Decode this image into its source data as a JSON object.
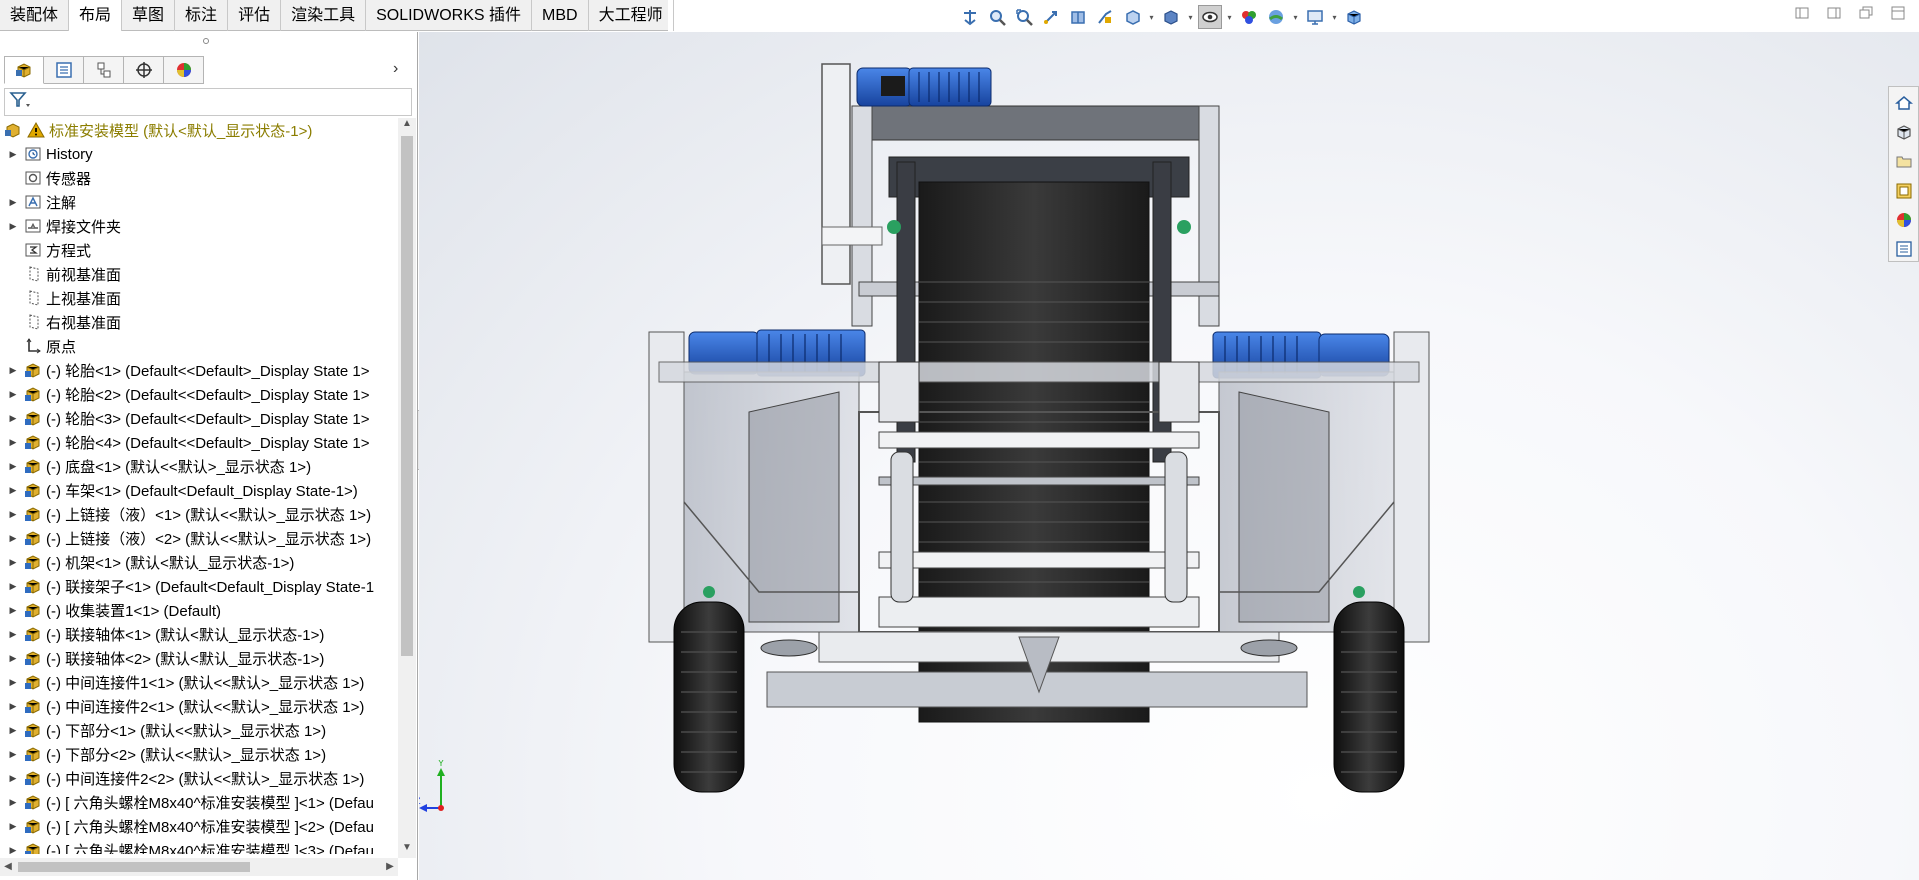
{
  "command_manager": {
    "tabs": [
      {
        "label": "装配体"
      },
      {
        "label": "布局"
      },
      {
        "label": "草图"
      },
      {
        "label": "标注"
      },
      {
        "label": "评估"
      },
      {
        "label": "渲染工具"
      },
      {
        "label": "SOLIDWORKS 插件"
      },
      {
        "label": "MBD"
      },
      {
        "label": "大工程师"
      }
    ],
    "active_tab": "布局"
  },
  "hud_toolbar": {
    "icons": [
      "orient-arrow-icon",
      "zoom-to-fit-icon",
      "zoom-area-icon",
      "previous-view-icon",
      "section-view-icon",
      "dynamic-annotation-icon",
      "view-orientation-icon",
      "display-style-icon",
      "hide-show-icon",
      "edit-appearance-icon",
      "apply-scene-icon",
      "view-settings-icon",
      "display-pane-icon"
    ]
  },
  "feature_manager": {
    "tabs": [
      "featuremanager-tab-icon",
      "propertymanager-tab-icon",
      "configurationmanager-tab-icon",
      "dimxpert-tab-icon",
      "displaymanager-tab-icon"
    ],
    "filter_icon": "funnel-icon",
    "root": {
      "label": "标准安装模型  (默认<默认_显示状态-1>)",
      "warning_color": "#e0a800"
    },
    "items": [
      {
        "label": "History",
        "icon": "history-icon",
        "expandable": true
      },
      {
        "label": "传感器",
        "icon": "sensor-icon",
        "expandable": false
      },
      {
        "label": "注解",
        "icon": "annotation-icon",
        "expandable": true
      },
      {
        "label": "焊接文件夹",
        "icon": "weld-folder-icon",
        "expandable": true
      },
      {
        "label": "方程式",
        "icon": "equation-icon",
        "expandable": false
      },
      {
        "label": "前视基准面",
        "icon": "plane-icon",
        "expandable": false
      },
      {
        "label": "上视基准面",
        "icon": "plane-icon",
        "expandable": false
      },
      {
        "label": "右视基准面",
        "icon": "plane-icon",
        "expandable": false
      },
      {
        "label": "原点",
        "icon": "origin-icon",
        "expandable": false
      },
      {
        "label": "(-) 轮胎<1> (Default<<Default>_Display State 1>",
        "icon": "part-icon",
        "expandable": true
      },
      {
        "label": "(-) 轮胎<2> (Default<<Default>_Display State 1>",
        "icon": "part-icon",
        "expandable": true
      },
      {
        "label": "(-) 轮胎<3> (Default<<Default>_Display State 1>",
        "icon": "part-icon",
        "expandable": true
      },
      {
        "label": "(-) 轮胎<4> (Default<<Default>_Display State 1>",
        "icon": "part-icon",
        "expandable": true
      },
      {
        "label": "(-) 底盘<1> (默认<<默认>_显示状态 1>)",
        "icon": "part-icon",
        "expandable": true
      },
      {
        "label": "(-) 车架<1> (Default<Default_Display State-1>)",
        "icon": "part-icon",
        "expandable": true
      },
      {
        "label": "(-) 上链接（液）<1> (默认<<默认>_显示状态 1>)",
        "icon": "part-icon",
        "expandable": true
      },
      {
        "label": "(-) 上链接（液）<2> (默认<<默认>_显示状态 1>)",
        "icon": "part-icon",
        "expandable": true
      },
      {
        "label": "(-) 机架<1> (默认<默认_显示状态-1>)",
        "icon": "part-icon",
        "expandable": true
      },
      {
        "label": "(-) 联接架子<1> (Default<Default_Display State-1",
        "icon": "part-icon",
        "expandable": true
      },
      {
        "label": "(-) 收集装置1<1> (Default)",
        "icon": "part-icon",
        "expandable": true
      },
      {
        "label": "(-) 联接轴体<1> (默认<默认_显示状态-1>)",
        "icon": "part-icon",
        "expandable": true
      },
      {
        "label": "(-) 联接轴体<2> (默认<默认_显示状态-1>)",
        "icon": "part-icon",
        "expandable": true
      },
      {
        "label": "(-) 中间连接件1<1> (默认<<默认>_显示状态 1>)",
        "icon": "part-icon",
        "expandable": true
      },
      {
        "label": "(-) 中间连接件2<1> (默认<<默认>_显示状态 1>)",
        "icon": "part-icon",
        "expandable": true
      },
      {
        "label": "(-) 下部分<1> (默认<<默认>_显示状态 1>)",
        "icon": "part-icon",
        "expandable": true
      },
      {
        "label": "(-) 下部分<2> (默认<<默认>_显示状态 1>)",
        "icon": "part-icon",
        "expandable": true
      },
      {
        "label": "(-) 中间连接件2<2> (默认<<默认>_显示状态 1>)",
        "icon": "part-icon",
        "expandable": true
      },
      {
        "label": "(-) [ 六角头螺栓M8x40^标准安装模型 ]<1> (Defau",
        "icon": "part-icon",
        "expandable": true
      },
      {
        "label": "(-) [ 六角头螺栓M8x40^标准安装模型 ]<2> (Defau",
        "icon": "part-icon",
        "expandable": true
      },
      {
        "label": "(-) [ 六角头螺栓M8x40^标准安装模型 ]<3> (Defau",
        "icon": "part-icon",
        "expandable": true
      }
    ]
  },
  "triad": {
    "y_label": "Y",
    "z_label": "Z",
    "x_color": "#e02020",
    "y_color": "#20b020",
    "z_color": "#2040e0"
  },
  "task_pane": {
    "icons": [
      "home-icon",
      "design-library-icon",
      "file-explorer-icon",
      "view-palette-icon",
      "appearances-icon",
      "custom-properties-icon"
    ]
  },
  "colors": {
    "motor_blue": "#1f57c8",
    "belt_black": "#262626",
    "frame_grey": "#b8bcc4",
    "accent_yellow": "#e0a800"
  }
}
